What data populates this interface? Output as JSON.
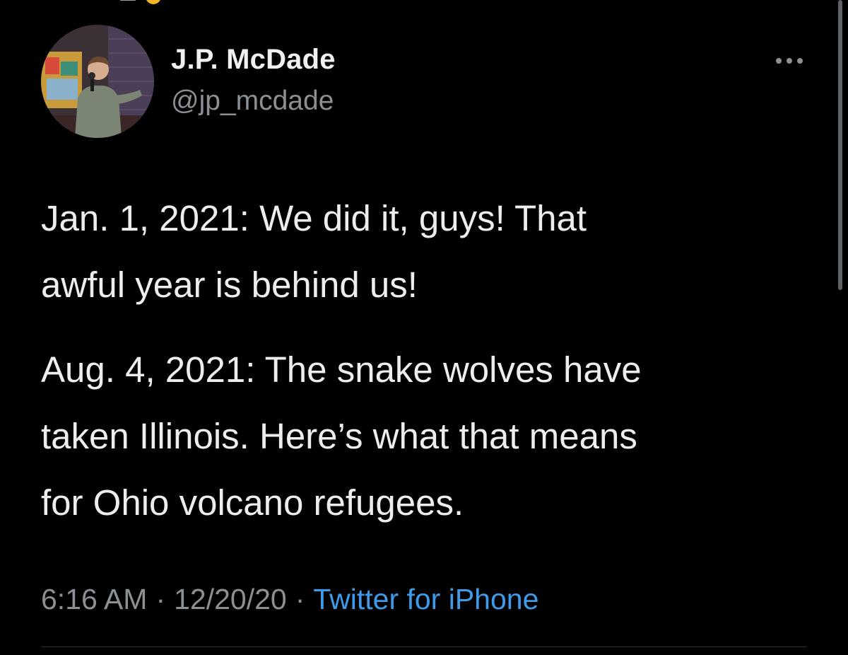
{
  "tweet": {
    "author": {
      "name": "J.P. McDade",
      "handle": "@jp_mcdade"
    },
    "paragraphs": [
      "Jan. 1, 2021: We did it, guys! That\nawful year is behind us!",
      "Aug. 4, 2021: The snake wolves have\ntaken Illinois. Here’s what that means\nfor Ohio volcano refugees."
    ],
    "meta": {
      "time": "6:16 AM",
      "date": "12/20/20",
      "separator": "·",
      "source": "Twitter for iPhone"
    },
    "icons": {
      "more": "more-horizontal-icon",
      "avatar": "profile-photo"
    }
  },
  "theme": {
    "background": "#000000",
    "text": "#ecedee",
    "secondary_text": "#8b9095",
    "link": "#3d9be9",
    "divider": "#2f3336"
  }
}
